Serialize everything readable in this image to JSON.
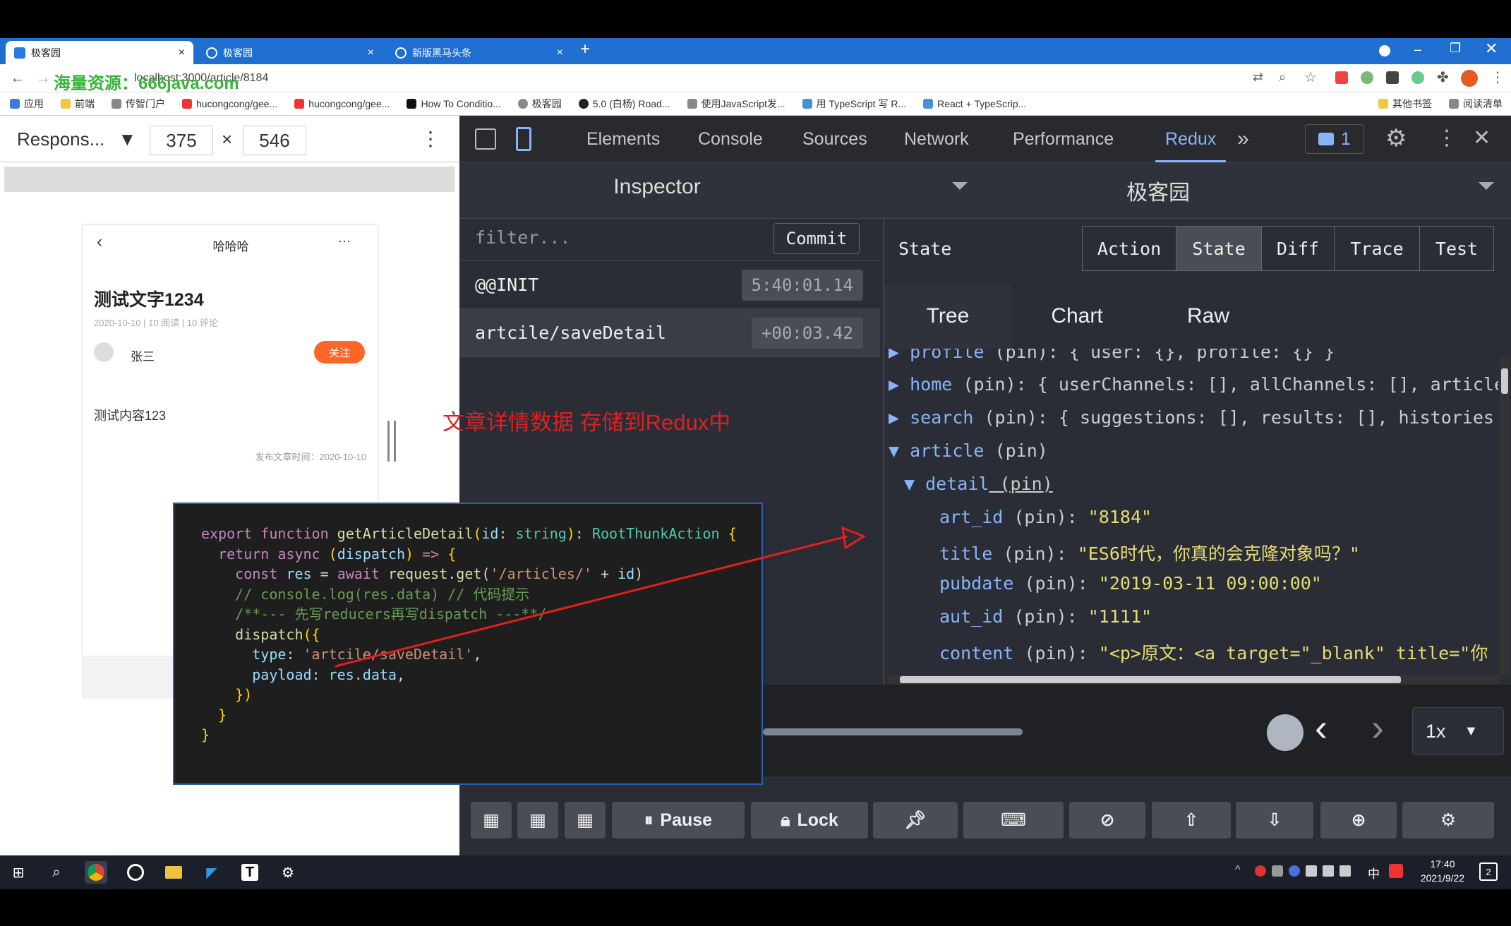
{
  "browser": {
    "tabs": [
      {
        "title": "极客园",
        "close": "×"
      },
      {
        "title": "极客园",
        "close": "×"
      },
      {
        "title": "新版黑马头条",
        "close": "×"
      }
    ],
    "new_tab": "+",
    "url": "localhost:3000/article/8184",
    "watermark": "海量资源：666java.com",
    "bookmarks": [
      "应用",
      "前端",
      "传智门户",
      "hucongcong/gee...",
      "hucongcong/gee...",
      "How To Conditio...",
      "极客园",
      "5.0 (白杨) Road...",
      "使用JavaScript发...",
      "用 TypeScript 写 R...",
      "React + TypeScrip..."
    ],
    "bookmarks_right": [
      "其他书签",
      "阅读清单"
    ]
  },
  "device_toolbar": {
    "preset": "Respons...",
    "width": "375",
    "times": "×",
    "height": "546"
  },
  "phone": {
    "nav_title": "哈哈哈",
    "more": "···",
    "article_title": "测试文字1234",
    "meta": "2020-10-10 | 10 阅读 | 10 评论",
    "author": "张三",
    "follow": "关注",
    "content": "测试内容123",
    "publish_time": "发布文章时间：2020-10-10"
  },
  "devtools_tabs": [
    "Elements",
    "Console",
    "Sources",
    "Network",
    "Performance",
    "Redux"
  ],
  "devtools_more": "»",
  "issues_count": "1",
  "redux": {
    "inspector_title": "Inspector",
    "instance_title": "极客园",
    "filter_placeholder": "filter...",
    "commit": "Commit",
    "actions": [
      {
        "name": "@@INIT",
        "time": "5:40:01.14"
      },
      {
        "name": "artcile/saveDetail",
        "time": "+00:03.42"
      }
    ],
    "monitor_label": "State",
    "monitor_tabs": [
      "Action",
      "State",
      "Diff",
      "Trace",
      "Test"
    ],
    "view_tabs": [
      "Tree",
      "Chart",
      "Raw"
    ],
    "tree": [
      {
        "arrow": "▶",
        "key": "profile",
        "pin": " (pin): ",
        "val": "{ user: {}, profile: {} }"
      },
      {
        "arrow": "▶",
        "key": "home",
        "pin": " (pin): ",
        "val": "{ userChannels: [], allChannels: [], articles"
      },
      {
        "arrow": "▶",
        "key": "search",
        "pin": " (pin): ",
        "val": "{ suggestions: [], results: [], histories: "
      },
      {
        "arrow": "▼",
        "key": "article",
        "pin": " (pin)",
        "val": ""
      },
      {
        "arrow": "▼",
        "key": "detail",
        "pin": " (pin)",
        "val": ""
      },
      {
        "arrow": "",
        "key": "art_id",
        "pin": " (pin): ",
        "val": "\"8184\""
      },
      {
        "arrow": "",
        "key": "title",
        "pin": " (pin): ",
        "val": "\"ES6时代，你真的会克隆对象吗？\""
      },
      {
        "arrow": "",
        "key": "pubdate",
        "pin": " (pin): ",
        "val": "\"2019-03-11 09:00:00\""
      },
      {
        "arrow": "",
        "key": "aut_id",
        "pin": " (pin): ",
        "val": "\"1111\""
      },
      {
        "arrow": "",
        "key": "content",
        "pin": " (pin): ",
        "val": "\"<p>原文：<a target=\"_blank\" title=\"你"
      }
    ],
    "speed": "1x",
    "bottom_buttons": {
      "pause": "Pause",
      "lock": "Lock"
    }
  },
  "annotation": "文章详情数据  存储到Redux中",
  "code_lines": [
    "export function getArticleDetail(id: string): RootThunkAction {",
    "  return async (dispatch) => {",
    "    const res = await request.get('/articles/' + id)",
    "    // console.log(res.data) // 代码提示",
    "",
    "    /**--- 先写reducers再写dispatch ---**/",
    "    dispatch({",
    "      type: 'artcile/saveDetail',",
    "      payload: res.data,",
    "    })",
    "  }",
    "}"
  ],
  "taskbar": {
    "time": "17:40",
    "date": "2021/9/22",
    "ime": "中",
    "notify": "2"
  }
}
